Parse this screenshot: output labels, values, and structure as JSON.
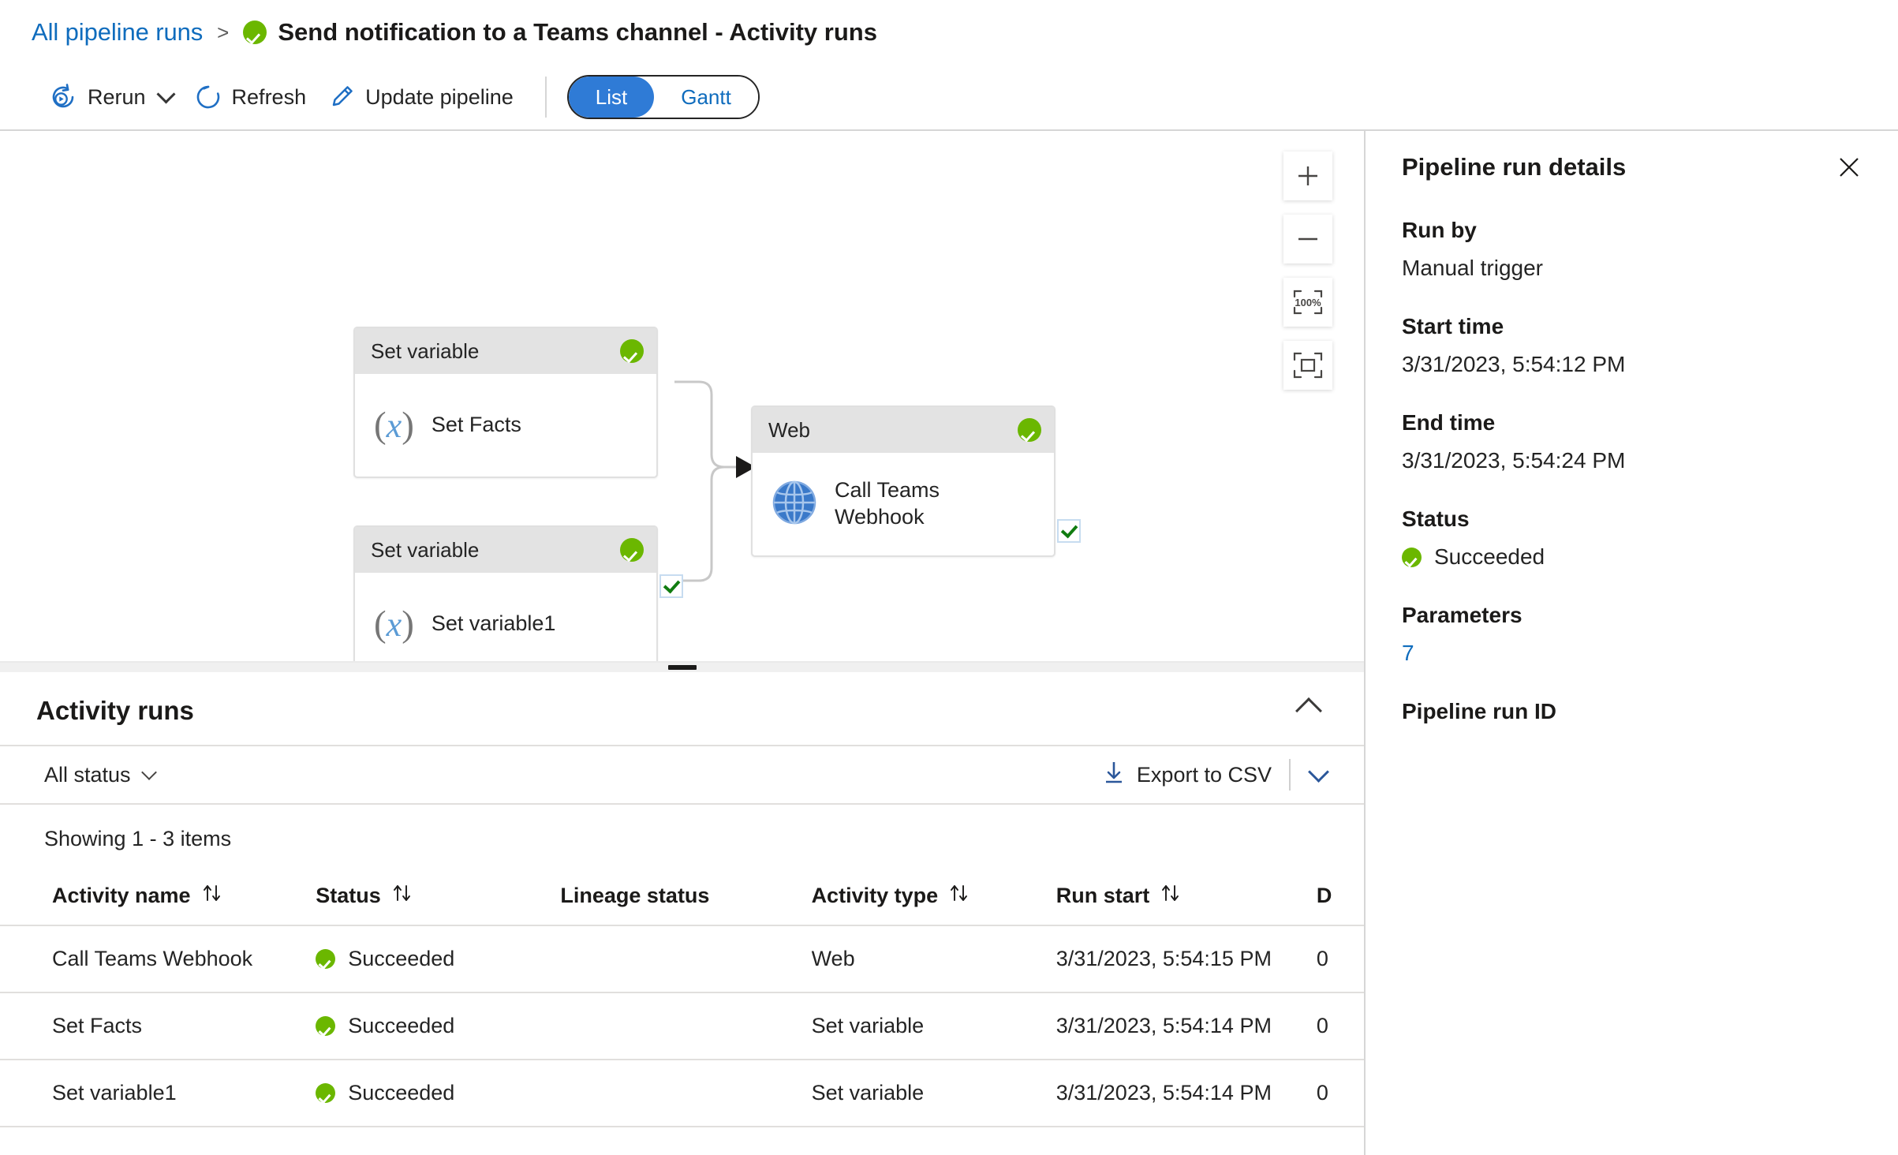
{
  "breadcrumb": {
    "parent_label": "All pipeline runs",
    "separator": ">",
    "current_label": "Send notification to a Teams channel - Activity runs",
    "current_status_icon": "success-check-icon"
  },
  "toolbar": {
    "rerun_label": "Rerun",
    "rerun_icon": "rerun-icon",
    "refresh_label": "Refresh",
    "refresh_icon": "refresh-icon",
    "update_pipeline_label": "Update pipeline",
    "update_pipeline_icon": "pencil-icon",
    "view_toggle": {
      "options": [
        "List",
        "Gantt"
      ],
      "selected": "List",
      "list_label": "List",
      "gantt_label": "Gantt"
    }
  },
  "canvas": {
    "zoom_controls": [
      {
        "name": "zoom-in",
        "glyph": "+"
      },
      {
        "name": "zoom-out",
        "glyph": "−"
      },
      {
        "name": "zoom-to-100",
        "glyph": "100%"
      },
      {
        "name": "zoom-to-fit",
        "glyph": "fit"
      }
    ],
    "zoom_100_label": "100%",
    "nodes": [
      {
        "type_label": "Set variable",
        "name": "Set Facts",
        "icon": "set-variable-icon",
        "status": "Succeeded",
        "status_icon": "success-check-icon"
      },
      {
        "type_label": "Set variable",
        "name": "Set variable1",
        "icon": "set-variable-icon",
        "status": "Succeeded",
        "status_icon": "success-check-icon"
      },
      {
        "type_label": "Web",
        "name": "Call Teams Webhook",
        "name_line1": "Call Teams",
        "name_line2": "Webhook",
        "icon": "globe-icon",
        "status": "Succeeded",
        "status_icon": "success-check-icon"
      }
    ]
  },
  "activity_runs": {
    "title": "Activity runs",
    "collapse_icon": "chevron-up-icon",
    "status_filter": {
      "value": "All status",
      "caret_icon": "chevron-down-icon"
    },
    "export": {
      "label": "Export to CSV",
      "icon": "download-icon",
      "caret_icon": "chevron-down-icon"
    },
    "showing_text": "Showing 1 - 3 items",
    "columns": [
      {
        "label": "Activity name",
        "sortable": true
      },
      {
        "label": "Status",
        "sortable": true
      },
      {
        "label": "Lineage status",
        "sortable": false
      },
      {
        "label": "Activity type",
        "sortable": true
      },
      {
        "label": "Run start",
        "sortable": true
      },
      {
        "label": "D",
        "sortable": false
      }
    ],
    "rows": [
      {
        "activity_name": "Call Teams Webhook",
        "status": "Succeeded",
        "status_icon": "success-check-icon",
        "lineage_status": "",
        "activity_type": "Web",
        "run_start": "3/31/2023, 5:54:15 PM",
        "duration": "0"
      },
      {
        "activity_name": "Set Facts",
        "status": "Succeeded",
        "status_icon": "success-check-icon",
        "lineage_status": "",
        "activity_type": "Set variable",
        "run_start": "3/31/2023, 5:54:14 PM",
        "duration": "0"
      },
      {
        "activity_name": "Set variable1",
        "status": "Succeeded",
        "status_icon": "success-check-icon",
        "lineage_status": "",
        "activity_type": "Set variable",
        "run_start": "3/31/2023, 5:54:14 PM",
        "duration": "0"
      }
    ]
  },
  "details_panel": {
    "title": "Pipeline run details",
    "close_icon": "close-icon",
    "run_by_label": "Run by",
    "run_by_value": "Manual trigger",
    "start_time_label": "Start time",
    "start_time_value": "3/31/2023, 5:54:12 PM",
    "end_time_label": "End time",
    "end_time_value": "3/31/2023, 5:54:24 PM",
    "status_label": "Status",
    "status_value": "Succeeded",
    "status_icon": "success-check-icon",
    "parameters_label": "Parameters",
    "parameters_value": "7",
    "pipeline_run_id_label": "Pipeline run ID",
    "pipeline_run_id_value": ""
  },
  "colors": {
    "accent_blue": "#0f6cbd",
    "toggle_blue": "#2f7bd6",
    "success_green": "#6bb700",
    "node_header_gray": "#e3e3e3",
    "border_gray": "#e1dfdd",
    "globe_blue": "#3a79c9"
  }
}
